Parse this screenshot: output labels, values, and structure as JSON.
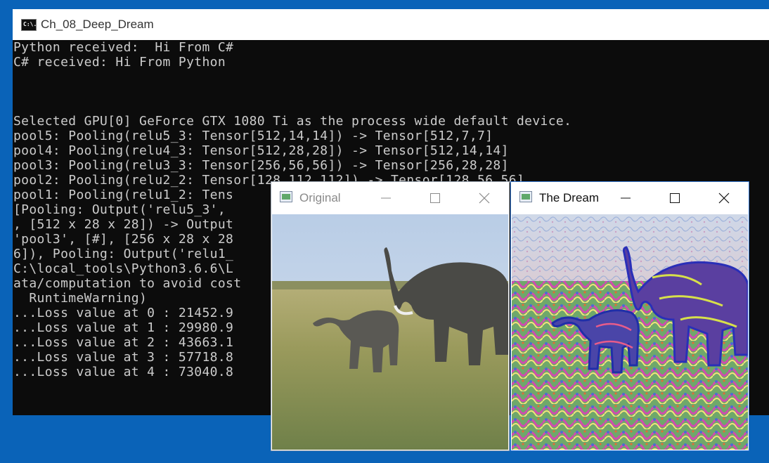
{
  "console": {
    "icon_text": "C:\\.",
    "title": "Ch_08_Deep_Dream",
    "lines": [
      "Python received:  Hi From C#",
      "C# received: Hi From Python",
      "",
      "",
      "",
      "Selected GPU[0] GeForce GTX 1080 Ti as the process wide default device.",
      "pool5: Pooling(relu5_3: Tensor[512,14,14]) -> Tensor[512,7,7]",
      "pool4: Pooling(relu4_3: Tensor[512,28,28]) -> Tensor[512,14,14]",
      "pool3: Pooling(relu3_3: Tensor[256,56,56]) -> Tensor[256,28,28]",
      "pool2: Pooling(relu2_2: Tensor[128,112,112]) -> Tensor[128,56,56]",
      "pool1: Pooling(relu1_2: Tens                                     ",
      "[Pooling: Output('relu5_3',                                              7",
      ", [512 x 28 x 28]) -> Output                                            u3",
      "'pool3', [#], [256 x 28 x 28                                             )",
      "6]), Pooling: Output('relu1_                                             4",
      "C:\\local_tools\\Python3.6.6\\L                                            ta",
      "ata/computation to avoid cost",
      "  RuntimeWarning)",
      "...Loss value at 0 : 21452.9",
      "...Loss value at 1 : 29980.9",
      "...Loss value at 2 : 43663.1",
      "...Loss value at 3 : 57718.8",
      "...Loss value at 4 : 73040.8"
    ]
  },
  "windows": {
    "original": {
      "title": "Original"
    },
    "dream": {
      "title": "The Dream"
    }
  },
  "colors": {
    "desktop": "#0a63b8",
    "console_bg": "#0c0c0c",
    "console_text": "#cccccc",
    "inactive_title": "#8a8a8a",
    "active_title": "#111111"
  }
}
